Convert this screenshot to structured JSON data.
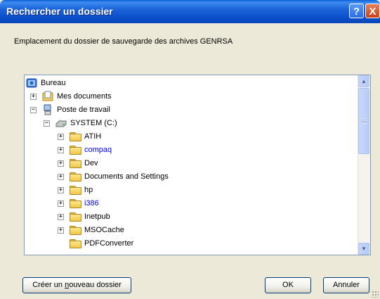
{
  "window": {
    "title": "Rechercher un dossier",
    "help_label": "?",
    "close_label": "X"
  },
  "description": "Emplacement du dossier de sauvegarde des archives GENRSA",
  "tree": {
    "items": [
      {
        "label": "Bureau",
        "icon": "desktop-icon",
        "expander": ""
      },
      {
        "label": "Mes documents",
        "icon": "my-documents-icon",
        "expander": "+"
      },
      {
        "label": "Poste de travail",
        "icon": "my-computer-icon",
        "expander": "−"
      },
      {
        "label": "SYSTEM (C:)",
        "icon": "drive-icon",
        "expander": "−"
      },
      {
        "label": "ATIH",
        "icon": "folder-icon",
        "expander": "+"
      },
      {
        "label": "compaq",
        "icon": "folder-icon",
        "expander": "+",
        "color": "#0000ff"
      },
      {
        "label": "Dev",
        "icon": "folder-icon",
        "expander": "+"
      },
      {
        "label": "Documents and Settings",
        "icon": "folder-icon",
        "expander": "+"
      },
      {
        "label": "hp",
        "icon": "folder-icon",
        "expander": "+"
      },
      {
        "label": "i386",
        "icon": "folder-icon",
        "expander": "+",
        "color": "#0000ff"
      },
      {
        "label": "Inetpub",
        "icon": "folder-icon",
        "expander": "+"
      },
      {
        "label": "MSOCache",
        "icon": "folder-icon",
        "expander": "+"
      },
      {
        "label": "PDFConverter",
        "icon": "folder-icon",
        "expander": ""
      }
    ]
  },
  "buttons": {
    "new_folder_pre": "Créer un ",
    "new_folder_key": "n",
    "new_folder_post": "ouveau dossier",
    "ok": "OK",
    "cancel": "Annuler"
  }
}
